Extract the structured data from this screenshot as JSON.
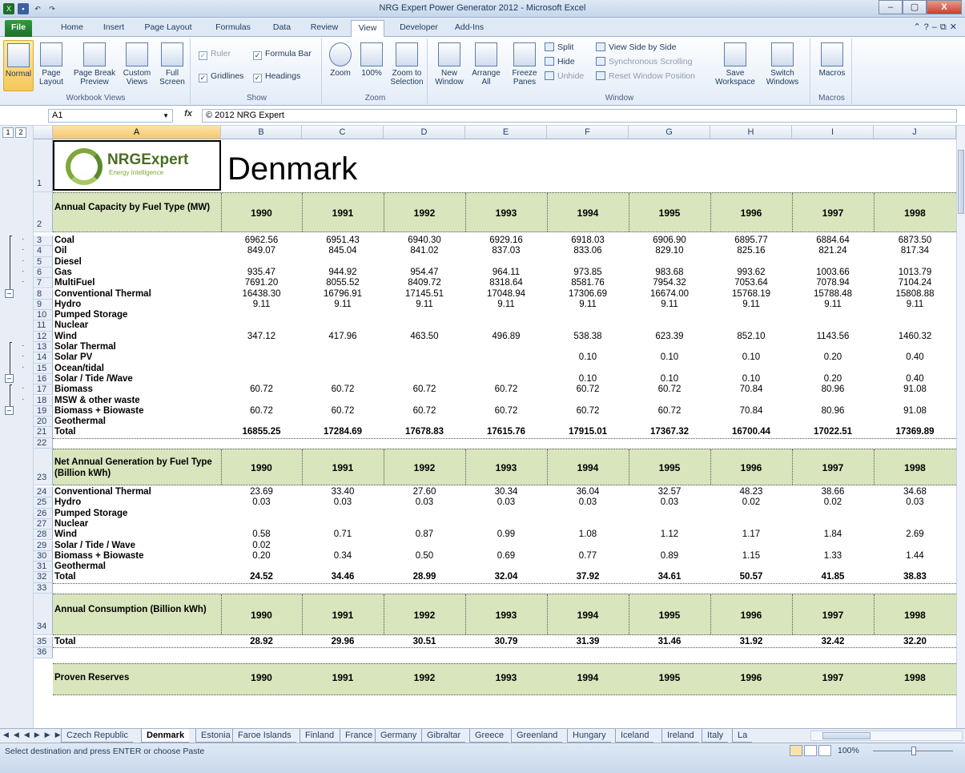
{
  "window": {
    "title": "NRG Expert Power Generator 2012  -  Microsoft Excel",
    "min": "–",
    "max": "▢",
    "close": "X"
  },
  "ribbon_tabs": [
    "File",
    "Home",
    "Insert",
    "Page Layout",
    "Formulas",
    "Data",
    "Review",
    "View",
    "Developer",
    "Add-Ins"
  ],
  "active_tab": "View",
  "ribbon": {
    "workbook_views": {
      "label": "Workbook Views",
      "normal": "Normal",
      "page_layout": "Page Layout",
      "page_break": "Page Break Preview",
      "custom_views": "Custom Views",
      "full_screen": "Full Screen"
    },
    "show": {
      "label": "Show",
      "ruler": "Ruler",
      "formula_bar": "Formula Bar",
      "gridlines": "Gridlines",
      "headings": "Headings"
    },
    "zoom": {
      "label": "Zoom",
      "zoom": "Zoom",
      "hundred": "100%",
      "zoom_sel": "Zoom to Selection"
    },
    "window": {
      "label": "Window",
      "new_window": "New Window",
      "arrange_all": "Arrange All",
      "freeze_panes": "Freeze Panes",
      "split": "Split",
      "hide": "Hide",
      "unhide": "Unhide",
      "side_by_side": "View Side by Side",
      "sync_scroll": "Synchronous Scrolling",
      "reset_pos": "Reset Window Position",
      "save_ws": "Save Workspace",
      "switch_win": "Switch Windows"
    },
    "macros": {
      "label": "Macros",
      "macros": "Macros"
    }
  },
  "formula_bar": {
    "cell_ref": "A1",
    "fx": "fx",
    "content": "© 2012 NRG Expert"
  },
  "outline_levels": [
    "1",
    "2"
  ],
  "columns": [
    "A",
    "B",
    "C",
    "D",
    "E",
    "F",
    "G",
    "H",
    "I",
    "J"
  ],
  "sheet": {
    "country": "Denmark",
    "logo_text": "NRGExpert",
    "logo_sub": "Energy Intelligence",
    "years": [
      "1990",
      "1991",
      "1992",
      "1993",
      "1994",
      "1995",
      "1996",
      "1997",
      "1998"
    ],
    "capacity": {
      "header": "Annual Capacity by Fuel Type (MW)",
      "rows": [
        {
          "r": "3",
          "label": "Coal",
          "v": [
            "6962.56",
            "6951.43",
            "6940.30",
            "6929.16",
            "6918.03",
            "6906.90",
            "6895.77",
            "6884.64",
            "6873.50"
          ]
        },
        {
          "r": "4",
          "label": "Oil",
          "v": [
            "849.07",
            "845.04",
            "841.02",
            "837.03",
            "833.06",
            "829.10",
            "825.16",
            "821.24",
            "817.34"
          ]
        },
        {
          "r": "5",
          "label": "Diesel",
          "v": [
            "",
            "",
            "",
            "",
            "",
            "",
            "",
            "",
            ""
          ]
        },
        {
          "r": "6",
          "label": "Gas",
          "v": [
            "935.47",
            "944.92",
            "954.47",
            "964.11",
            "973.85",
            "983.68",
            "993.62",
            "1003.66",
            "1013.79"
          ]
        },
        {
          "r": "7",
          "label": "MultiFuel",
          "v": [
            "7691.20",
            "8055.52",
            "8409.72",
            "8318.64",
            "8581.76",
            "7954.32",
            "7053.64",
            "7078.94",
            "7104.24"
          ]
        },
        {
          "r": "8",
          "label": "Conventional Thermal",
          "v": [
            "16438.30",
            "16796.91",
            "17145.51",
            "17048.94",
            "17306.69",
            "16674.00",
            "15768.19",
            "15788.48",
            "15808.88"
          ]
        },
        {
          "r": "9",
          "label": "Hydro",
          "v": [
            "9.11",
            "9.11",
            "9.11",
            "9.11",
            "9.11",
            "9.11",
            "9.11",
            "9.11",
            "9.11"
          ]
        },
        {
          "r": "10",
          "label": "Pumped Storage",
          "v": [
            "",
            "",
            "",
            "",
            "",
            "",
            "",
            "",
            ""
          ]
        },
        {
          "r": "11",
          "label": "Nuclear",
          "v": [
            "",
            "",
            "",
            "",
            "",
            "",
            "",
            "",
            ""
          ]
        },
        {
          "r": "12",
          "label": "Wind",
          "v": [
            "347.12",
            "417.96",
            "463.50",
            "496.89",
            "538.38",
            "623.39",
            "852.10",
            "1143.56",
            "1460.32"
          ]
        },
        {
          "r": "13",
          "label": "Solar Thermal",
          "v": [
            "",
            "",
            "",
            "",
            "",
            "",
            "",
            "",
            ""
          ]
        },
        {
          "r": "14",
          "label": "Solar PV",
          "v": [
            "",
            "",
            "",
            "",
            "0.10",
            "0.10",
            "0.10",
            "0.20",
            "0.40"
          ]
        },
        {
          "r": "15",
          "label": "Ocean/tidal",
          "v": [
            "",
            "",
            "",
            "",
            "",
            "",
            "",
            "",
            ""
          ]
        },
        {
          "r": "16",
          "label": "Solar / Tide /Wave",
          "v": [
            "",
            "",
            "",
            "",
            "0.10",
            "0.10",
            "0.10",
            "0.20",
            "0.40"
          ]
        },
        {
          "r": "17",
          "label": "Biomass",
          "v": [
            "60.72",
            "60.72",
            "60.72",
            "60.72",
            "60.72",
            "60.72",
            "70.84",
            "80.96",
            "91.08"
          ]
        },
        {
          "r": "18",
          "label": "MSW & other waste",
          "v": [
            "",
            "",
            "",
            "",
            "",
            "",
            "",
            "",
            ""
          ]
        },
        {
          "r": "19",
          "label": "Biomass + Biowaste",
          "v": [
            "60.72",
            "60.72",
            "60.72",
            "60.72",
            "60.72",
            "60.72",
            "70.84",
            "80.96",
            "91.08"
          ]
        },
        {
          "r": "20",
          "label": "Geothermal",
          "v": [
            "",
            "",
            "",
            "",
            "",
            "",
            "",
            "",
            ""
          ]
        },
        {
          "r": "21",
          "label": "Total",
          "v": [
            "16855.25",
            "17284.69",
            "17678.83",
            "17615.76",
            "17915.01",
            "17367.32",
            "16700.44",
            "17022.51",
            "17369.89"
          ]
        }
      ]
    },
    "generation": {
      "header": "Net Annual Generation by Fuel Type (Billion kWh)",
      "rows": [
        {
          "r": "24",
          "label": "Conventional Thermal",
          "v": [
            "23.69",
            "33.40",
            "27.60",
            "30.34",
            "36.04",
            "32.57",
            "48.23",
            "38.66",
            "34.68"
          ]
        },
        {
          "r": "25",
          "label": "Hydro",
          "v": [
            "0.03",
            "0.03",
            "0.03",
            "0.03",
            "0.03",
            "0.03",
            "0.02",
            "0.02",
            "0.03"
          ]
        },
        {
          "r": "26",
          "label": "Pumped Storage",
          "v": [
            "",
            "",
            "",
            "",
            "",
            "",
            "",
            "",
            ""
          ]
        },
        {
          "r": "27",
          "label": "Nuclear",
          "v": [
            "",
            "",
            "",
            "",
            "",
            "",
            "",
            "",
            ""
          ]
        },
        {
          "r": "28",
          "label": "Wind",
          "v": [
            "0.58",
            "0.71",
            "0.87",
            "0.99",
            "1.08",
            "1.12",
            "1.17",
            "1.84",
            "2.69"
          ]
        },
        {
          "r": "29",
          "label": "Solar / Tide / Wave",
          "v": [
            "0.02",
            "",
            "",
            "",
            "",
            "",
            "",
            "",
            ""
          ]
        },
        {
          "r": "30",
          "label": "Biomass + Biowaste",
          "v": [
            "0.20",
            "0.34",
            "0.50",
            "0.69",
            "0.77",
            "0.89",
            "1.15",
            "1.33",
            "1.44"
          ]
        },
        {
          "r": "31",
          "label": "Geothermal",
          "v": [
            "",
            "",
            "",
            "",
            "",
            "",
            "",
            "",
            ""
          ]
        },
        {
          "r": "32",
          "label": "Total",
          "v": [
            "24.52",
            "34.46",
            "28.99",
            "32.04",
            "37.92",
            "34.61",
            "50.57",
            "41.85",
            "38.83"
          ]
        }
      ]
    },
    "consumption": {
      "header": "Annual Consumption (Billion kWh)",
      "rows": [
        {
          "r": "35",
          "label": "Total",
          "v": [
            "28.92",
            "29.96",
            "30.51",
            "30.79",
            "31.39",
            "31.46",
            "31.92",
            "32.42",
            "32.20"
          ]
        }
      ]
    },
    "reserves": {
      "header": "Proven Reserves"
    }
  },
  "sheet_tabs": [
    "Czech Republic",
    "Denmark",
    "Estonia",
    "Faroe Islands",
    "Finland",
    "France",
    "Germany",
    "Gibraltar",
    "Greece",
    "Greenland",
    "Hungary",
    "Iceland",
    "Ireland",
    "Italy",
    "La"
  ],
  "active_sheet": "Denmark",
  "status": {
    "text": "Select destination and press ENTER or choose Paste",
    "zoom": "100%"
  }
}
